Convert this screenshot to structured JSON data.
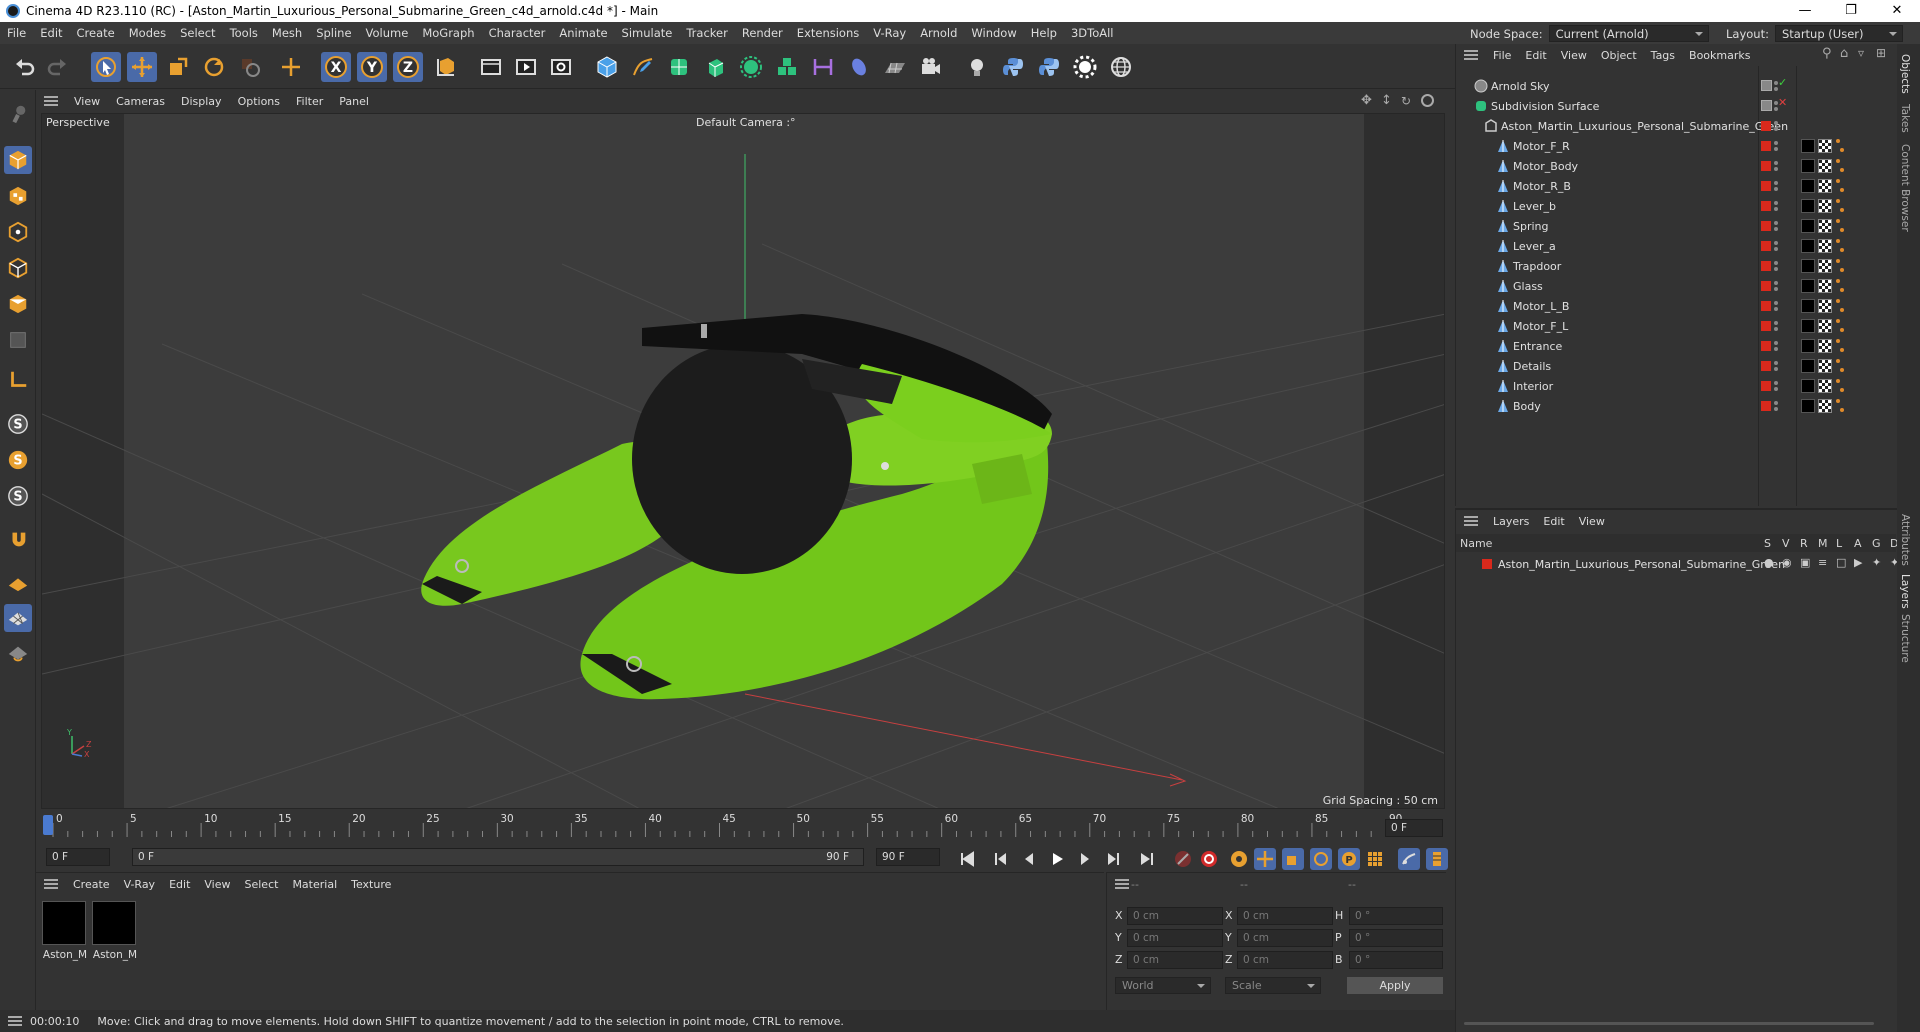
{
  "window": {
    "title": "Cinema 4D R23.110 (RC) - [Aston_Martin_Luxurious_Personal_Submarine_Green_c4d_arnold.c4d *] - Main"
  },
  "menubar": {
    "items": [
      "File",
      "Edit",
      "Create",
      "Modes",
      "Select",
      "Tools",
      "Mesh",
      "Spline",
      "Volume",
      "MoGraph",
      "Character",
      "Animate",
      "Simulate",
      "Tracker",
      "Render",
      "Extensions",
      "V-Ray",
      "Arnold",
      "Window",
      "Help",
      "3DToAll"
    ],
    "node_space_label": "Node Space:",
    "node_space_value": "Current (Arnold)",
    "layout_label": "Layout:",
    "layout_value": "Startup (User)"
  },
  "viewport": {
    "menu": [
      "View",
      "Cameras",
      "Display",
      "Options",
      "Filter",
      "Panel"
    ],
    "name": "Perspective",
    "camera": "Default Camera :°",
    "grid_spacing": "Grid Spacing : 50 cm",
    "axis_y": "Y",
    "axis_x": "X",
    "axis_z": "Z"
  },
  "timeline": {
    "ticks": [
      "0",
      "5",
      "10",
      "15",
      "20",
      "25",
      "30",
      "35",
      "40",
      "45",
      "50",
      "55",
      "60",
      "65",
      "70",
      "75",
      "80",
      "85",
      "90"
    ],
    "current_frame": "0 F"
  },
  "transport": {
    "start_field": "0 F",
    "range_start": "0 F",
    "range_end": "90 F",
    "end_field": "90 F"
  },
  "materials": {
    "menu": [
      "Create",
      "V-Ray",
      "Edit",
      "View",
      "Select",
      "Material",
      "Texture"
    ],
    "items": [
      "Aston_M",
      "Aston_M"
    ]
  },
  "coords": {
    "header": [
      "--",
      "--",
      "--"
    ],
    "rows": [
      {
        "a": "X",
        "av": "0 cm",
        "b": "X",
        "bv": "0 cm",
        "c": "H",
        "cv": "0 °"
      },
      {
        "a": "Y",
        "av": "0 cm",
        "b": "Y",
        "bv": "0 cm",
        "c": "P",
        "cv": "0 °"
      },
      {
        "a": "Z",
        "av": "0 cm",
        "b": "Z",
        "bv": "0 cm",
        "c": "B",
        "cv": "0 °"
      }
    ],
    "world": "World",
    "scale": "Scale",
    "apply": "Apply"
  },
  "status": {
    "time": "00:00:10",
    "message": "Move: Click and drag to move elements. Hold down SHIFT to quantize movement / add to the selection in point mode, CTRL to remove."
  },
  "objects": {
    "menu": [
      "File",
      "Edit",
      "View",
      "Object",
      "Tags",
      "Bookmarks"
    ],
    "top": [
      {
        "name": "Arnold Sky"
      },
      {
        "name": "Subdivision Surface"
      },
      {
        "name": "Aston_Martin_Luxurious_Personal_Submarine_Green"
      }
    ],
    "children": [
      "Motor_F_R",
      "Motor_Body",
      "Motor_R_B",
      "Lever_b",
      "Spring",
      "Lever_a",
      "Trapdoor",
      "Glass",
      "Motor_L_B",
      "Motor_F_L",
      "Entrance",
      "Details",
      "Interior",
      "Body"
    ]
  },
  "layers": {
    "menu": [
      "Layers",
      "Edit",
      "View"
    ],
    "col_name": "Name",
    "cols": [
      "S",
      "V",
      "R",
      "M",
      "L",
      "A",
      "G",
      "D"
    ],
    "items": [
      "Aston_Martin_Luxurious_Personal_Submarine_Green"
    ]
  },
  "sidetabs": [
    "Objects",
    "Takes",
    "Content Browser",
    "Attributes",
    "Layers",
    "Structure"
  ],
  "colors": {
    "accent": "#4a6aa8",
    "green_model": "#7ed321",
    "red_tag": "#d9291c"
  }
}
